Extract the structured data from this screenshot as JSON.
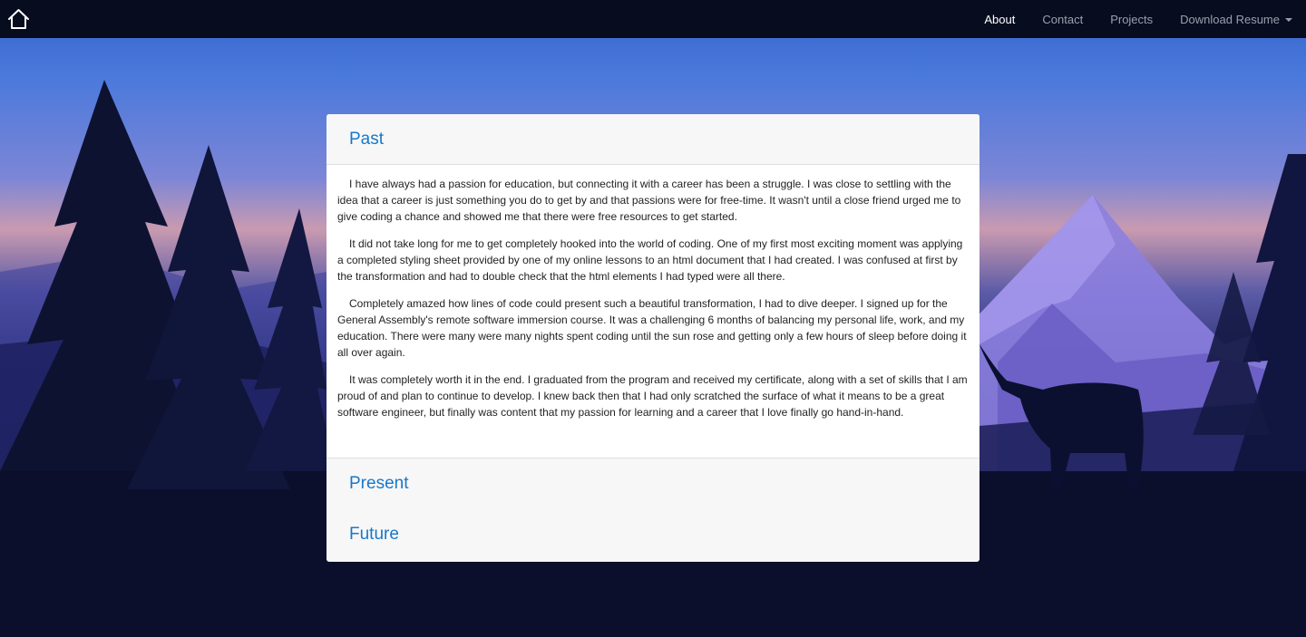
{
  "navbar": {
    "home_icon": "home-icon",
    "links": [
      {
        "label": "About",
        "active": true
      },
      {
        "label": "Contact",
        "active": false
      },
      {
        "label": "Projects",
        "active": false
      },
      {
        "label": "Download Resume",
        "active": false,
        "dropdown": true
      }
    ]
  },
  "accordion": {
    "sections": [
      {
        "title": "Past",
        "expanded": true,
        "paragraphs": [
          "I have always had a passion for education, but connecting it with a career has been a struggle. I was close to settling with the idea that a career is just something you do to get by and that passions were for free-time. It wasn't until a close friend urged me to give coding a chance and showed me that there were free resources to get started.",
          "It did not take long for me to get completely hooked into the world of coding. One of my first most exciting moment was applying a completed styling sheet provided by one of my online lessons to an html document that I had created. I was confused at first by the transformation and had to double check that the html elements I had typed were all there.",
          "Completely amazed how lines of code could present such a beautiful transformation, I had to dive deeper. I signed up for the General Assembly's remote software immersion course. It was a challenging 6 months of balancing my personal life, work, and my education. There were many were many nights spent coding until the sun rose and getting only a few hours of sleep before doing it all over again.",
          "It was completely worth it in the end. I graduated from the program and received my certificate, along with a set of skills that I am proud of and plan to continue to develop. I knew back then that I had only scratched the surface of what it means to be a great software engineer, but finally was content that my passion for learning and a career that I love finally go hand-in-hand."
        ]
      },
      {
        "title": "Present",
        "expanded": false
      },
      {
        "title": "Future",
        "expanded": false
      }
    ]
  },
  "colors": {
    "navbar_bg": "#070c1f",
    "accent": "#1878c9",
    "card_bg": "#f7f7f7"
  }
}
